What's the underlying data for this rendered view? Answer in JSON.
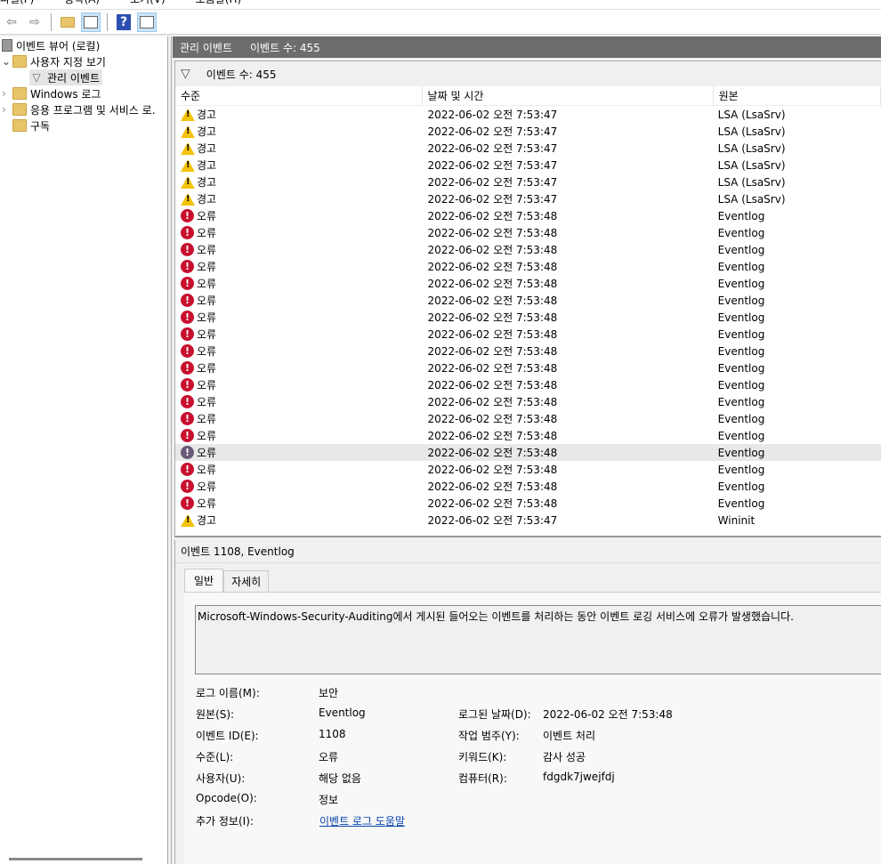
{
  "menu": [
    "파일(F)",
    "동작(A)",
    "보기(V)",
    "도움말(H)"
  ],
  "toolbar": {
    "icons": [
      "back-arrow-icon",
      "forward-arrow-icon",
      "up-folder-icon",
      "show-hide-console-tree-icon",
      "help-icon",
      "show-hide-action-pane-icon"
    ]
  },
  "tree": {
    "root": "이벤트 뷰어 (로컬)",
    "custom_views": "사용자 지정 보기",
    "admin_events": "관리 이벤트",
    "windows_logs": "Windows 로그",
    "app_service_logs": "응용 프로그램 및 서비스 로.",
    "subscriptions": "구독"
  },
  "header": {
    "title": "관리 이벤트",
    "count": "이벤트 수: 455"
  },
  "filter": {
    "count": "이벤트 수: 455"
  },
  "columns": [
    "수준",
    "날짜 및 시간",
    "원본"
  ],
  "rows": [
    [
      "경고",
      "2022-06-02 오전 7:53:47",
      "LSA (LsaSrv)",
      "warn"
    ],
    [
      "경고",
      "2022-06-02 오전 7:53:47",
      "LSA (LsaSrv)",
      "warn"
    ],
    [
      "경고",
      "2022-06-02 오전 7:53:47",
      "LSA (LsaSrv)",
      "warn"
    ],
    [
      "경고",
      "2022-06-02 오전 7:53:47",
      "LSA (LsaSrv)",
      "warn"
    ],
    [
      "경고",
      "2022-06-02 오전 7:53:47",
      "LSA (LsaSrv)",
      "warn"
    ],
    [
      "경고",
      "2022-06-02 오전 7:53:47",
      "LSA (LsaSrv)",
      "warn"
    ],
    [
      "오류",
      "2022-06-02 오전 7:53:48",
      "Eventlog",
      "err"
    ],
    [
      "오류",
      "2022-06-02 오전 7:53:48",
      "Eventlog",
      "err"
    ],
    [
      "오류",
      "2022-06-02 오전 7:53:48",
      "Eventlog",
      "err"
    ],
    [
      "오류",
      "2022-06-02 오전 7:53:48",
      "Eventlog",
      "err"
    ],
    [
      "오류",
      "2022-06-02 오전 7:53:48",
      "Eventlog",
      "err"
    ],
    [
      "오류",
      "2022-06-02 오전 7:53:48",
      "Eventlog",
      "err"
    ],
    [
      "오류",
      "2022-06-02 오전 7:53:48",
      "Eventlog",
      "err"
    ],
    [
      "오류",
      "2022-06-02 오전 7:53:48",
      "Eventlog",
      "err"
    ],
    [
      "오류",
      "2022-06-02 오전 7:53:48",
      "Eventlog",
      "err"
    ],
    [
      "오류",
      "2022-06-02 오전 7:53:48",
      "Eventlog",
      "err"
    ],
    [
      "오류",
      "2022-06-02 오전 7:53:48",
      "Eventlog",
      "err"
    ],
    [
      "오류",
      "2022-06-02 오전 7:53:48",
      "Eventlog",
      "err"
    ],
    [
      "오류",
      "2022-06-02 오전 7:53:48",
      "Eventlog",
      "err"
    ],
    [
      "오류",
      "2022-06-02 오전 7:53:48",
      "Eventlog",
      "err"
    ],
    [
      "오류",
      "2022-06-02 오전 7:53:48",
      "Eventlog",
      "err-selected"
    ],
    [
      "오류",
      "2022-06-02 오전 7:53:48",
      "Eventlog",
      "err"
    ],
    [
      "오류",
      "2022-06-02 오전 7:53:48",
      "Eventlog",
      "err"
    ],
    [
      "오류",
      "2022-06-02 오전 7:53:48",
      "Eventlog",
      "err"
    ],
    [
      "경고",
      "2022-06-02 오전 7:53:47",
      "Wininit",
      "warn"
    ]
  ],
  "detail": {
    "title": "이벤트 1108, Eventlog",
    "tabs": [
      "일반",
      "자세히"
    ],
    "description": "Microsoft-Windows-Security-Auditing에서 게시된 들어오는 이벤트를 처리하는 동안 이벤트 로깅 서비스에 오류가 발생했습니다.",
    "fields": [
      {
        "label": "로그 이름(M):",
        "value": "보안"
      },
      {
        "label": "원본(S):",
        "value": "Eventlog"
      },
      {
        "label": "이벤트 ID(E):",
        "value": "1108"
      },
      {
        "label": "수준(L):",
        "value": "오류"
      },
      {
        "label": "사용자(U):",
        "value": "해당 없음"
      },
      {
        "label": "Opcode(O):",
        "value": "정보"
      },
      {
        "label": "추가 정보(I):",
        "value": "이벤트 로그 도움말"
      }
    ],
    "fields_right": [
      {
        "label": "로그된 날짜(D):",
        "value": "2022-06-02 오전 7:53:48"
      },
      {
        "label": "작업 범주(Y):",
        "value": "이벤트 처리"
      },
      {
        "label": "키워드(K):",
        "value": "감사 성공"
      },
      {
        "label": "컴퓨터(R):",
        "value": "fdgdk7jwejfdj"
      }
    ]
  }
}
